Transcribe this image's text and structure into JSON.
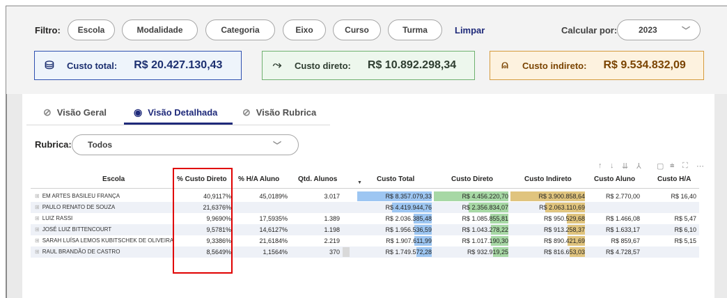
{
  "filters": {
    "label": "Filtro:",
    "pills": [
      "Escola",
      "Modalidade",
      "Categoria",
      "Eixo",
      "Curso",
      "Turma"
    ],
    "clear": "Limpar",
    "calc_label": "Calcular por:",
    "year": "2023"
  },
  "kpis": {
    "total": {
      "label": "Custo total:",
      "value": "R$ 20.427.130,43",
      "icon": "coins-icon"
    },
    "direto": {
      "label": "Custo direto:",
      "value": "R$ 10.892.298,34",
      "icon": "arrow-right-icon"
    },
    "indireto": {
      "label": "Custo indireto:",
      "value": "R$ 9.534.832,09",
      "icon": "people-icon"
    }
  },
  "tabs": [
    {
      "label": "Visão Geral",
      "active": false
    },
    {
      "label": "Visão Detalhada",
      "active": true
    },
    {
      "label": "Visão Rubrica",
      "active": false
    }
  ],
  "rubrica": {
    "label": "Rubrica:",
    "value": "Todos"
  },
  "table": {
    "columns": [
      "Escola",
      "% Custo Direto",
      "% H/A Aluno",
      "Qtd. Alunos",
      "Custo Total",
      "Custo Direto",
      "Custo Indireto",
      "Custo Aluno",
      "Custo H/A"
    ],
    "rows": [
      {
        "escola": "EM ARTES BASILEU FRANÇA",
        "pct_direto": "40,9117%",
        "pct_ha": "45,0189%",
        "qtd": "3.017",
        "total": "R$ 8.357.079,33",
        "direto": "R$ 4.456.220,70",
        "indireto": "R$ 3.900.858,64",
        "aluno": "R$ 2.770,00",
        "ha": "R$ 16,40",
        "total_frac": 1.0,
        "direto_frac": 1.0,
        "indireto_frac": 1.0,
        "qtd_frac": 0
      },
      {
        "escola": "PAULO RENATO DE SOUZA",
        "pct_direto": "21,6376%",
        "pct_ha": "",
        "qtd": "",
        "total": "R$ 4.419.944,76",
        "direto": "R$ 2.356.834,07",
        "indireto": "R$ 2.063.110,69",
        "aluno": "",
        "ha": "",
        "total_frac": 0.53,
        "direto_frac": 0.53,
        "indireto_frac": 0.53,
        "qtd_frac": 0
      },
      {
        "escola": "LUIZ RASSI",
        "pct_direto": "9,9690%",
        "pct_ha": "17,5935%",
        "qtd": "1.389",
        "total": "R$ 2.036.385,48",
        "direto": "R$ 1.085.855,81",
        "indireto": "R$ 950.529,68",
        "aluno": "R$ 1.466,08",
        "ha": "R$ 5,47",
        "total_frac": 0.24,
        "direto_frac": 0.24,
        "indireto_frac": 0.24,
        "qtd_frac": 0
      },
      {
        "escola": "JOSÉ LUIZ BITTENCOURT",
        "pct_direto": "9,5781%",
        "pct_ha": "14,6127%",
        "qtd": "1.198",
        "total": "R$ 1.956.536,59",
        "direto": "R$ 1.043.278,22",
        "indireto": "R$ 913.258,37",
        "aluno": "R$ 1.633,17",
        "ha": "R$ 6,10",
        "total_frac": 0.23,
        "direto_frac": 0.23,
        "indireto_frac": 0.23,
        "qtd_frac": 0
      },
      {
        "escola": "SARAH LUÍSA LEMOS KUBITSCHEK DE OLIVEIRA",
        "pct_direto": "9,3386%",
        "pct_ha": "21,6184%",
        "qtd": "2.219",
        "total": "R$ 1.907.611,99",
        "direto": "R$ 1.017.190,30",
        "indireto": "R$ 890.421,69",
        "aluno": "R$ 859,67",
        "ha": "R$ 5,15",
        "total_frac": 0.23,
        "direto_frac": 0.23,
        "indireto_frac": 0.23,
        "qtd_frac": 0
      },
      {
        "escola": "RAUL BRANDÃO DE CASTRO",
        "pct_direto": "8,5649%",
        "pct_ha": "1,1564%",
        "qtd": "370",
        "total": "R$ 1.749.572,28",
        "direto": "R$ 932.919,25",
        "indireto": "R$ 816.653,03",
        "aluno": "R$ 4.728,57",
        "ha": "",
        "total_frac": 0.21,
        "direto_frac": 0.21,
        "indireto_frac": 0.21,
        "qtd_frac": 0.12
      }
    ]
  },
  "colors": {
    "brand": "#1f2a7a",
    "bar_total": "#9dc6f2",
    "bar_direto": "#a7d8a5",
    "bar_indireto": "#e0c47e",
    "highlight": "#e00000"
  }
}
